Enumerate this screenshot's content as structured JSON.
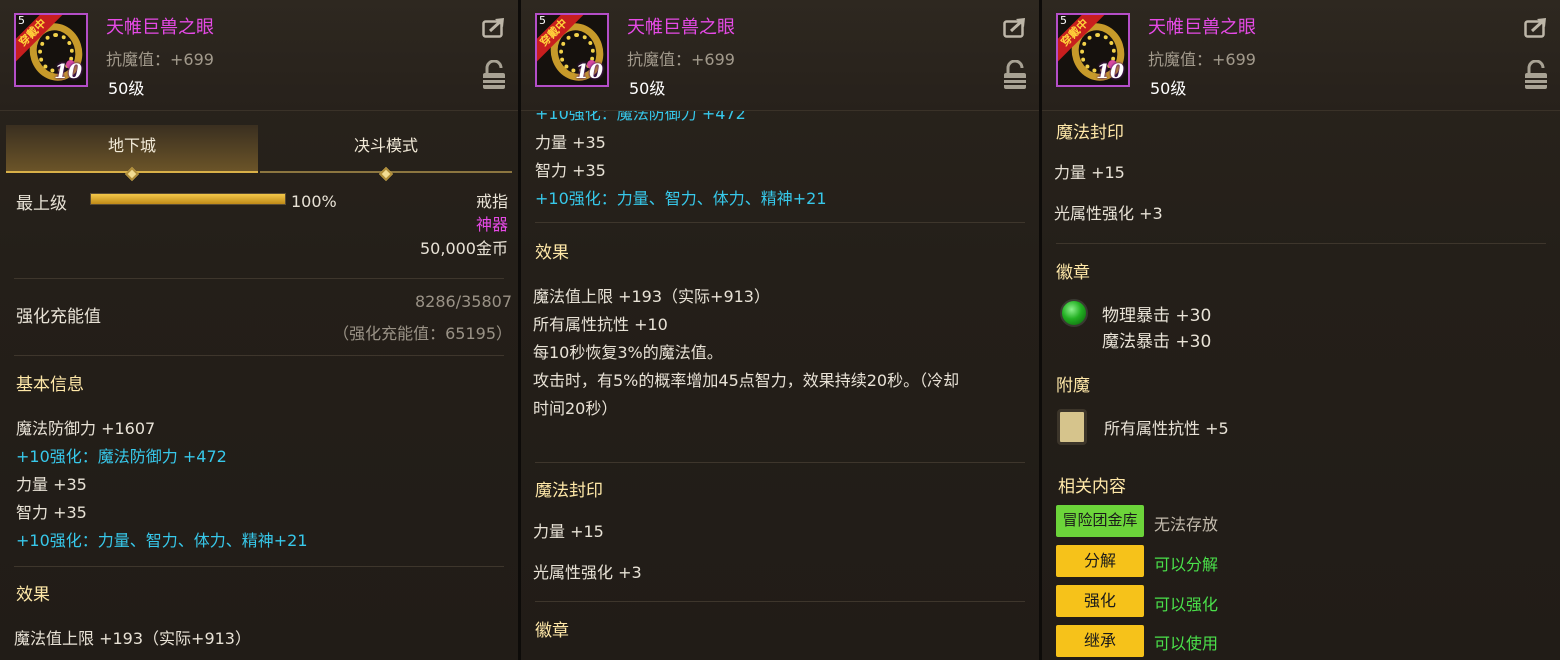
{
  "item": {
    "name": "天帷巨兽之眼",
    "stat_line": "抗魔值：+699",
    "level": "50级",
    "ribbon": "穿戴中",
    "corner_num": "5",
    "enhance_badge": "10"
  },
  "tabs": [
    {
      "label": "地下城",
      "active": true
    },
    {
      "label": "决斗模式",
      "active": false
    }
  ],
  "grade": {
    "label": "最上级",
    "percent_text": "100%",
    "percent": 100
  },
  "slot": {
    "type": "戒指",
    "rarity": "神器",
    "price": "50,000金币"
  },
  "charge": {
    "label": "强化充能值",
    "value": "8286/35807",
    "note": "（强化充能值：65195）"
  },
  "basic": {
    "title": "基本信息",
    "lines": [
      "魔法防御力 +1607",
      "+10强化：魔法防御力 +472",
      "力量 +35",
      "智力 +35",
      "+10强化：力量、智力、体力、精神+21"
    ]
  },
  "effect": {
    "title": "效果",
    "lines": [
      "魔法值上限 +193（实际+913）",
      "所有属性抗性 +10",
      "每10秒恢复3%的魔法值。",
      "攻击时，有5%的概率增加45点智力，效果持续20秒。（冷却",
      "时间20秒）"
    ]
  },
  "magic_seal": {
    "title": "魔法封印",
    "lines": [
      "力量 +15",
      "光属性强化 +3"
    ]
  },
  "emblem": {
    "title": "徽章",
    "lines": [
      "物理暴击 +30",
      "魔法暴击 +30"
    ]
  },
  "enchant": {
    "title": "附魔",
    "line": "所有属性抗性 +5"
  },
  "related": {
    "title": "相关内容",
    "rows": [
      {
        "button": "冒险团金库",
        "status": "无法存放"
      },
      {
        "button": "分解",
        "status": "可以分解"
      },
      {
        "button": "强化",
        "status": "可以强化"
      },
      {
        "button": "继承",
        "status": "可以使用"
      }
    ]
  },
  "colors": {
    "item_name": "#e64ae6",
    "enhance_text": "#37c8ea",
    "section_title": "#ffe8a8",
    "ok_text": "#4ae04a",
    "button_yellow": "#f6c21a",
    "button_green": "#6cd43a"
  }
}
